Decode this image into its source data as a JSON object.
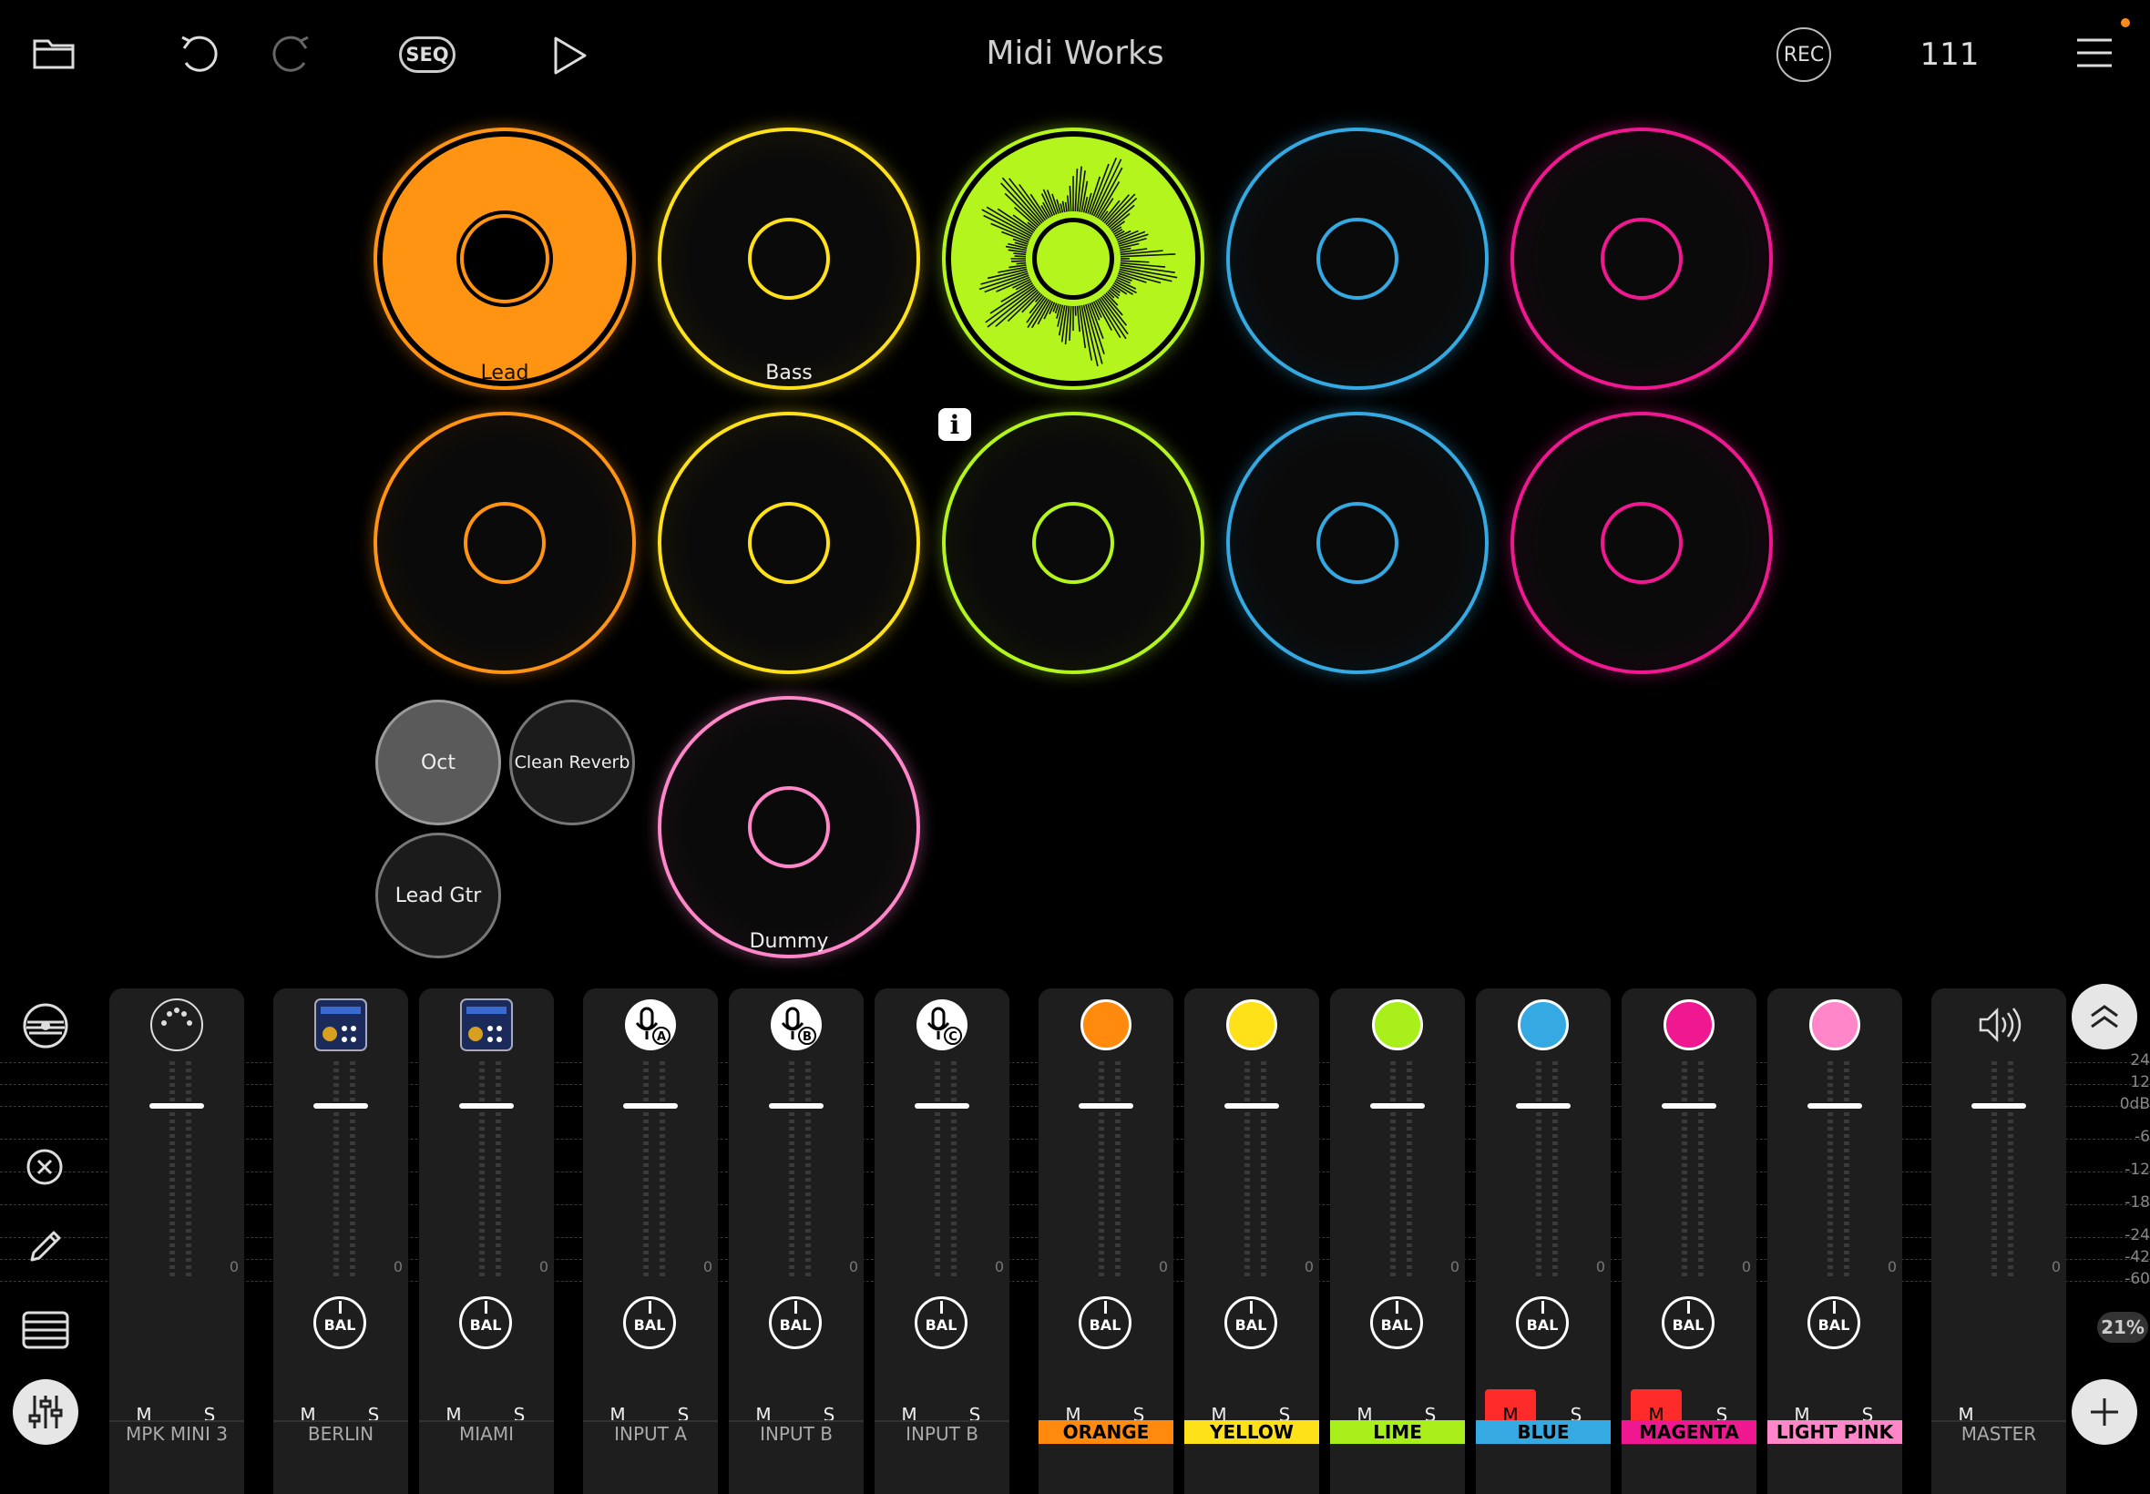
{
  "topbar": {
    "title": "Midi Works",
    "seq_label": "SEQ",
    "rec_label": "REC",
    "tempo": "111",
    "icons": [
      "folder-icon",
      "undo-icon",
      "redo-icon",
      "play-icon",
      "hamburger-menu-icon"
    ]
  },
  "pads": {
    "row1": [
      {
        "label": "Lead",
        "color": "#ff9312",
        "state": "filled"
      },
      {
        "label": "Bass",
        "color": "#ffe11a",
        "state": "outline"
      },
      {
        "label": "",
        "color": "#b3f51c",
        "state": "playing"
      },
      {
        "label": "",
        "color": "#34a9e2",
        "state": "outline"
      },
      {
        "label": "",
        "color": "#ef1891",
        "state": "outline"
      }
    ],
    "row2": [
      {
        "label": "",
        "color": "#ff9312"
      },
      {
        "label": "",
        "color": "#ffe11a"
      },
      {
        "label": "",
        "color": "#b3f51c"
      },
      {
        "label": "",
        "color": "#34a9e2"
      },
      {
        "label": "",
        "color": "#ef1891"
      }
    ],
    "dummy": {
      "label": "Dummy",
      "color": "#ff86c8"
    }
  },
  "fx": {
    "oct": "Oct",
    "clean_reverb": "Clean Reverb",
    "lead_gtr": "Lead Gtr"
  },
  "mixer": {
    "strips": [
      {
        "name": "MPK MINI 3",
        "icon": "midi-din-icon",
        "m": "M",
        "s": "S",
        "show_bal": false,
        "zero": "0"
      },
      {
        "name": "BERLIN",
        "icon": "synth-plugin-icon",
        "m": "M",
        "s": "S",
        "bal": "BAL",
        "zero": "0"
      },
      {
        "name": "MIAMI",
        "icon": "synth-plugin-icon",
        "m": "M",
        "s": "S",
        "bal": "BAL",
        "zero": "0"
      },
      {
        "name": "INPUT A",
        "icon": "mic-input-a-icon",
        "m": "M",
        "s": "S",
        "bal": "BAL",
        "zero": "0"
      },
      {
        "name": "INPUT B",
        "icon": "mic-input-b-icon",
        "m": "M",
        "s": "S",
        "bal": "BAL",
        "zero": "0"
      },
      {
        "name": "INPUT B",
        "icon": "mic-input-c-icon",
        "m": "M",
        "s": "S",
        "bal": "BAL",
        "zero": "0"
      },
      {
        "name": "ORANGE",
        "color": "#ff8a0d",
        "m": "M",
        "s": "S",
        "bal": "BAL",
        "zero": "0"
      },
      {
        "name": "YELLOW",
        "color": "#ffe11a",
        "m": "M",
        "s": "S",
        "bal": "BAL",
        "zero": "0"
      },
      {
        "name": "LIME",
        "color": "#a8ef1c",
        "m": "M",
        "s": "S",
        "bal": "BAL",
        "zero": "0"
      },
      {
        "name": "BLUE",
        "color": "#34a9e2",
        "m": "M",
        "s": "S",
        "bal": "BAL",
        "zero": "0",
        "muted": true
      },
      {
        "name": "MAGENTA",
        "color": "#ef1891",
        "m": "M",
        "s": "S",
        "bal": "BAL",
        "zero": "0",
        "muted": true
      },
      {
        "name": "LIGHT PINK",
        "color": "#ff86c8",
        "m": "M",
        "s": "S",
        "bal": "BAL",
        "zero": "0"
      },
      {
        "name": "MASTER",
        "icon": "speaker-icon",
        "m": "M",
        "zero": "0"
      }
    ],
    "db_scale": [
      "24",
      "12",
      "0dB",
      "-6",
      "-12",
      "-18",
      "-24",
      "-42",
      "-60"
    ],
    "cpu_percent": "21%"
  },
  "colors": {
    "accent_orange": "#ff9312",
    "mute_red": "#ff2b2b",
    "strip_bg": "#1e1e1e"
  }
}
